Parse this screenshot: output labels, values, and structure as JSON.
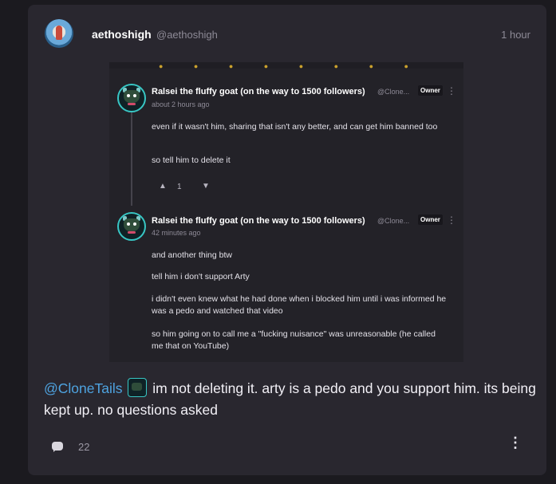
{
  "post": {
    "username": "aethoshigh",
    "handle": "@aethoshigh",
    "time": "1 hour",
    "comment": {
      "mention": "@CloneTails",
      "text": "im not deleting it. arty is a pedo and you support him. its being kept up. no questions asked"
    },
    "reply_count": "22"
  },
  "screenshot": {
    "comments": [
      {
        "name": "Ralsei the fluffy goat (on the way to 1500 followers)",
        "handle": "@Clone...",
        "badge": "Owner",
        "time": "about 2 hours ago",
        "paragraphs": [
          "even if it wasn't him, sharing that isn't any better, and can get him banned too",
          "so tell him to delete it"
        ],
        "likes": "1"
      },
      {
        "name": "Ralsei the fluffy goat (on the way to 1500 followers)",
        "handle": "@Clone...",
        "badge": "Owner",
        "time": "42 minutes ago",
        "paragraphs": [
          "and another thing btw",
          "tell him i don't support Arty",
          "i didn't even knew what he had done when i blocked him until i was informed he was a pedo and watched that video",
          "so him going on to call me a \"fucking nuisance\" was unreasonable (he called me that on YouTube)"
        ]
      }
    ]
  },
  "icons": {
    "comment": "speech-bubble-icon",
    "more": "vertical-dots-icon",
    "like": "thumbs-up-icon",
    "dislike": "thumbs-down-icon"
  },
  "colors": {
    "background": "#1b1a1f",
    "card": "#29272f",
    "mention": "#4ea3e0",
    "owner_ring": "#38c6c4"
  }
}
